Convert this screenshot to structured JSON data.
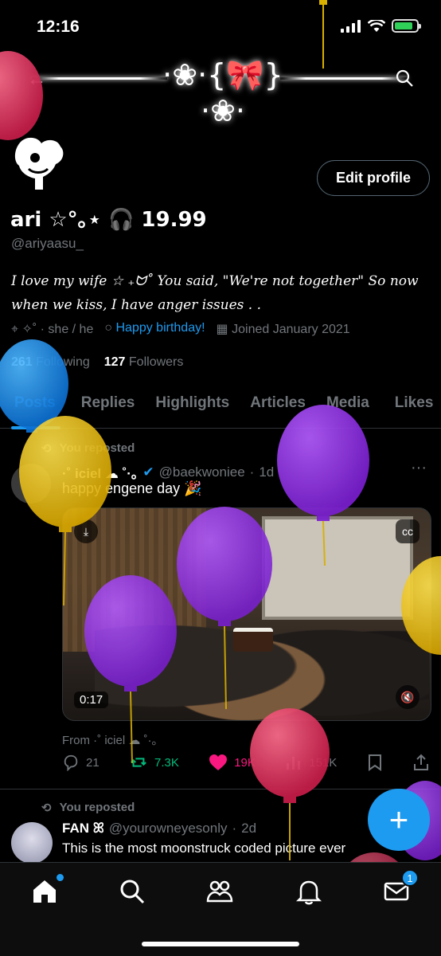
{
  "status_bar": {
    "time": "12:16"
  },
  "header": {
    "back_icon": "arrow-left-icon",
    "search_icon": "search-icon",
    "banner_ornament": "·❀·{🎀}·❀·"
  },
  "profile": {
    "name": "ari ☆°｡⋆ 🎧 19.99",
    "handle": "@ariyaasu_",
    "bio_line1": "I love my wife ☆ ₊ᗢ˚ You said, \"We're not together\" So now",
    "bio_line2": "when we kiss, I have anger issues . .",
    "location": "✧˚ · she / he",
    "birthday": "Happy birthday!",
    "joined": "Joined January 2021",
    "following_count": "261",
    "following_label": "Following",
    "followers_count": "127",
    "followers_label": "Followers",
    "edit_label": "Edit profile"
  },
  "tabs": [
    {
      "label": "Posts",
      "active": true
    },
    {
      "label": "Replies",
      "active": false
    },
    {
      "label": "Highlights",
      "active": false
    },
    {
      "label": "Articles",
      "active": false
    },
    {
      "label": "Media",
      "active": false
    },
    {
      "label": "Likes",
      "active": false
    }
  ],
  "tweet1": {
    "repost_label": "You reposted",
    "name": "·˚ iciel ☁ ˚·｡",
    "handle": "@baekwoniee",
    "time": "1d",
    "text": "happy engene day 🎉",
    "video_duration": "0:17",
    "from": "From ·˚ iciel ☁ ˚·｡",
    "replies": "21",
    "reposts": "7.3K",
    "likes": "19K",
    "views": "151K"
  },
  "tweet2": {
    "repost_label": "You reposted",
    "name": "FAN ꕤ",
    "handle": "@yourowneyesonly",
    "time": "2d",
    "text": "This is the most moonstruck coded picture ever"
  },
  "fab_label": "+",
  "nav": {
    "messages_badge": "1"
  },
  "colors": {
    "accent": "#1d9bf0",
    "repost": "#00ba7c",
    "like": "#f91880",
    "background": "#000000"
  }
}
